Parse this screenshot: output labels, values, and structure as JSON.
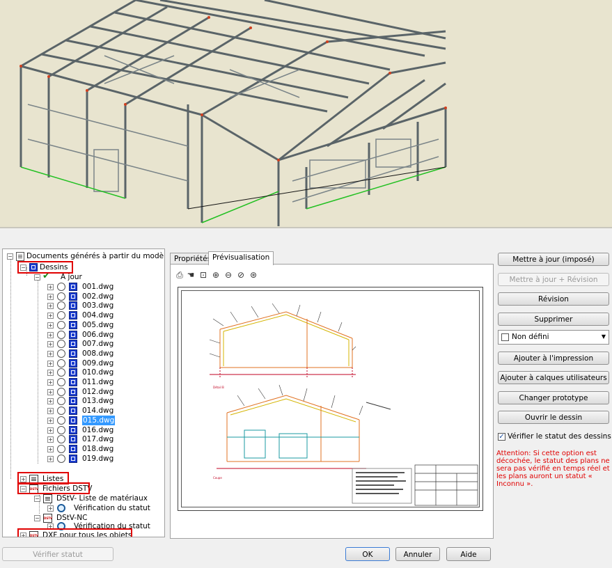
{
  "tree": {
    "root": "Documents générés à partir du modèle",
    "dessins": "Dessins",
    "a_jour": "À jour",
    "drawings": [
      "001.dwg",
      "002.dwg",
      "003.dwg",
      "004.dwg",
      "005.dwg",
      "006.dwg",
      "007.dwg",
      "008.dwg",
      "009.dwg",
      "010.dwg",
      "011.dwg",
      "012.dwg",
      "013.dwg",
      "014.dwg",
      "015.dwg",
      "016.dwg",
      "017.dwg",
      "018.dwg",
      "019.dwg"
    ],
    "selected": "015.dwg",
    "listes": "Listes",
    "fichiers_dstv": "Fichiers DSTV",
    "dstv_materiaux": "DStV- Liste de matériaux",
    "verif_statut_1": "Vérification du statut",
    "dstv_nc": "DStV-NC",
    "verif_statut_2": "Vérification du statut",
    "dxf": "DXF pour tous les objets"
  },
  "tabs": {
    "proprietes": "Propriétés",
    "previsualisation": "Prévisualisation"
  },
  "toolbar_icons": [
    "print-icon",
    "pan-icon",
    "zoom-window-icon",
    "zoom-in-icon",
    "zoom-out-icon",
    "zoom-previous-icon",
    "zoom-fit-icon"
  ],
  "buttons": {
    "mettre_a_jour": "Mettre à jour (imposé)",
    "mettre_a_jour_revision": "Mettre à jour + Révision",
    "revision": "Révision",
    "supprimer": "Supprimer",
    "ajouter_impression": "Ajouter à l'impression",
    "ajouter_calques": "Ajouter à calques utilisateurs",
    "changer_prototype": "Changer prototype",
    "ouvrir_dessin": "Ouvrir le dessin"
  },
  "select": {
    "value": "Non défini"
  },
  "checkbox": {
    "label": "Vérifier le statut des dessins",
    "checked": true
  },
  "warning": "Attention: Si cette option est décochée, le statut des plans ne sera pas vérifié en temps réel et les plans auront un statut « Inconnu ».",
  "bottom": {
    "verifier_statut": "Vérifier statut",
    "ok": "OK",
    "annuler": "Annuler",
    "aide": "Aide"
  },
  "preview_labels": {
    "coupe_1": "Détail B",
    "coupe_2": "Coupe"
  },
  "colors": {
    "viewport_bg": "#e8e4cf",
    "highlight_red": "#e00000",
    "selection_blue": "#3399ff",
    "dwg_icon": "#1a3ccf"
  }
}
